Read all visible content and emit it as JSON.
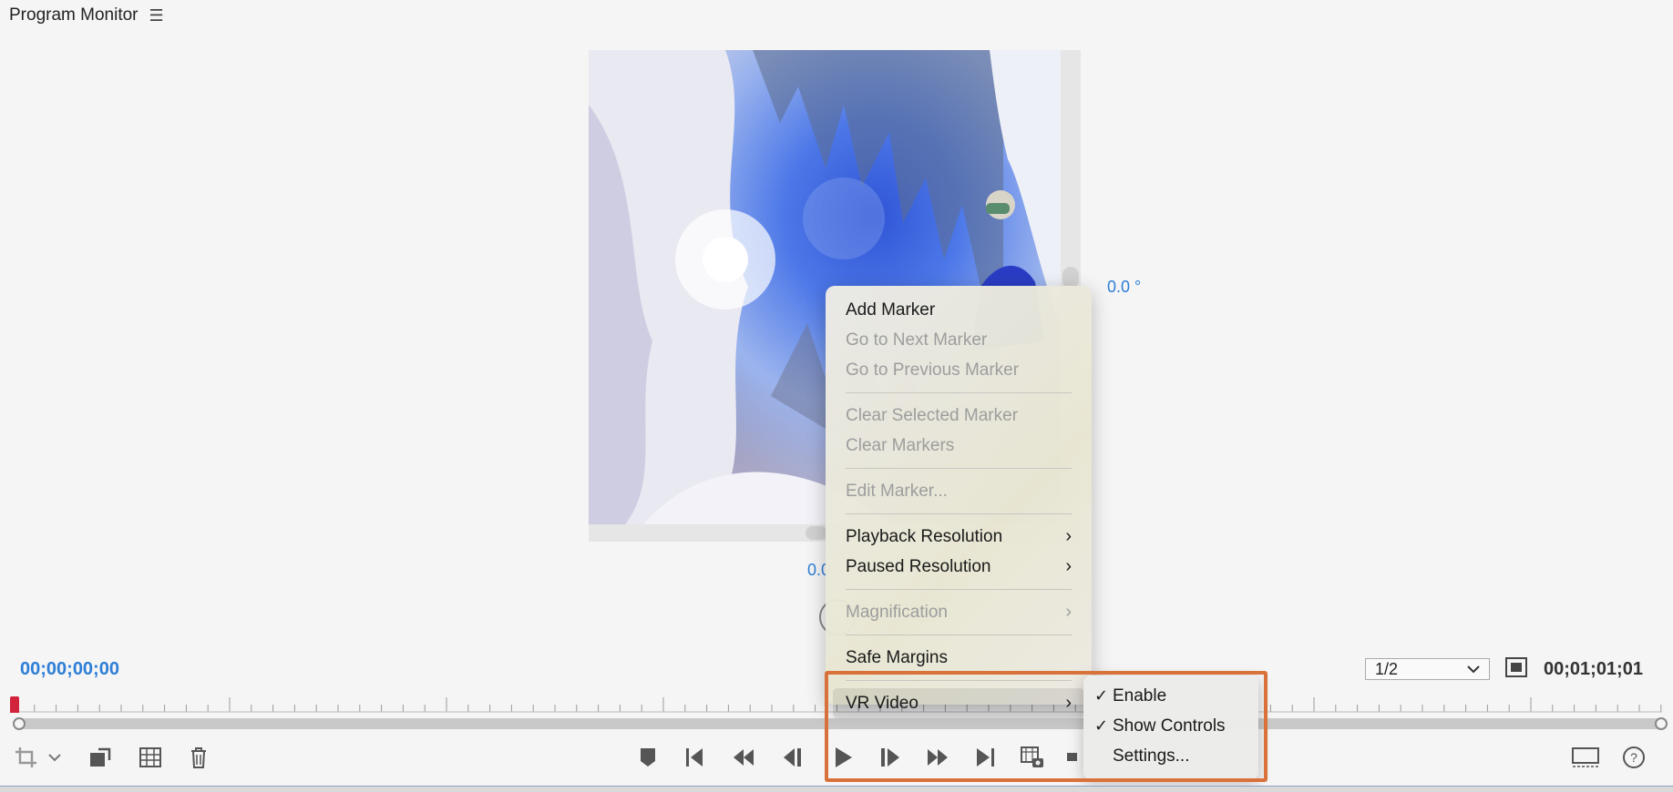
{
  "panel": {
    "title": "Program Monitor",
    "menu_icon": "hamburger-icon"
  },
  "viewer": {
    "pan_readout": "0.0 °",
    "tilt_readout": "0.0",
    "current_timecode": "00;00;00;00",
    "total_timecode": "00;01;01;01",
    "resolution": "1/2"
  },
  "context_menu": {
    "items": [
      {
        "label": "Add Marker",
        "enabled": true
      },
      {
        "label": "Go to Next Marker",
        "enabled": false
      },
      {
        "label": "Go to Previous Marker",
        "enabled": false
      },
      {
        "label": "Clear Selected Marker",
        "enabled": false
      },
      {
        "label": "Clear Markers",
        "enabled": false
      },
      {
        "label": "Edit Marker...",
        "enabled": false
      },
      {
        "label": "Playback Resolution",
        "enabled": true,
        "submenu": true
      },
      {
        "label": "Paused Resolution",
        "enabled": true,
        "submenu": true
      },
      {
        "label": "Magnification",
        "enabled": false,
        "submenu": true
      },
      {
        "label": "Safe Margins",
        "enabled": true
      },
      {
        "label": "VR Video",
        "enabled": true,
        "submenu": true,
        "highlighted": true
      }
    ],
    "chevron": "›"
  },
  "vr_submenu": {
    "items": [
      {
        "label": "Enable",
        "checked": true
      },
      {
        "label": "Show Controls",
        "checked": true
      },
      {
        "label": "Settings...",
        "checked": false
      }
    ],
    "check_glyph": "✓"
  },
  "toolbar": {
    "left_icons": [
      "crop-icon",
      "chevron-down-icon",
      "export-frame-icon",
      "multicam-grid-icon",
      "trash-icon"
    ],
    "center_icons": [
      "add-marker-icon",
      "go-to-in-icon",
      "step-back-icon",
      "step-frame-back-icon",
      "play-icon",
      "step-frame-forward-icon",
      "step-forward-icon",
      "go-to-out-icon",
      "export-frame-camera-icon",
      "insert-icon"
    ],
    "right_icons": [
      "comparison-view-icon",
      "help-icon"
    ]
  },
  "colors": {
    "accent_blue": "#2d7ed6",
    "highlight_orange": "#d9723a",
    "playhead_red": "#d2233c"
  }
}
